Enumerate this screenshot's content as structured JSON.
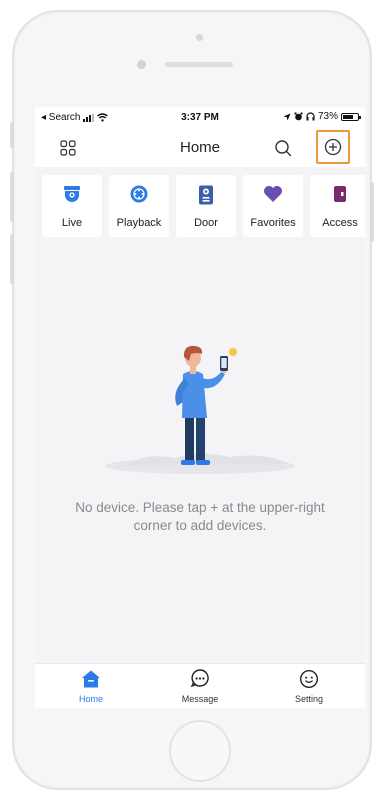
{
  "status_bar": {
    "back_label": "◂ Search",
    "time": "3:37 PM",
    "battery_percent": "73%",
    "battery_level": 0.73
  },
  "header": {
    "title": "Home",
    "menu_icon": "grid-icon",
    "search_icon": "search-icon",
    "add_icon": "plus-circle-icon"
  },
  "quick_actions": [
    {
      "label": "Live",
      "icon": "camera-icon",
      "color": "#2c7be5"
    },
    {
      "label": "Playback",
      "icon": "playback-icon",
      "color": "#2c7be5"
    },
    {
      "label": "Door",
      "icon": "door-icon",
      "color": "#3a5ea8"
    },
    {
      "label": "Favorites",
      "icon": "heart-icon",
      "color": "#6a4fb0"
    },
    {
      "label": "Access",
      "icon": "access-icon",
      "color": "#7a2b6e"
    }
  ],
  "empty_state": {
    "message": "No device. Please tap + at the upper-right corner to add devices."
  },
  "tab_bar": {
    "tabs": [
      {
        "label": "Home",
        "icon": "home-icon",
        "active": true
      },
      {
        "label": "Message",
        "icon": "message-icon",
        "active": false
      },
      {
        "label": "Setting",
        "icon": "setting-icon",
        "active": false
      }
    ]
  },
  "colors": {
    "accent": "#2c7be5",
    "highlight_border": "#e89a3c",
    "background": "#f4f4f6"
  }
}
